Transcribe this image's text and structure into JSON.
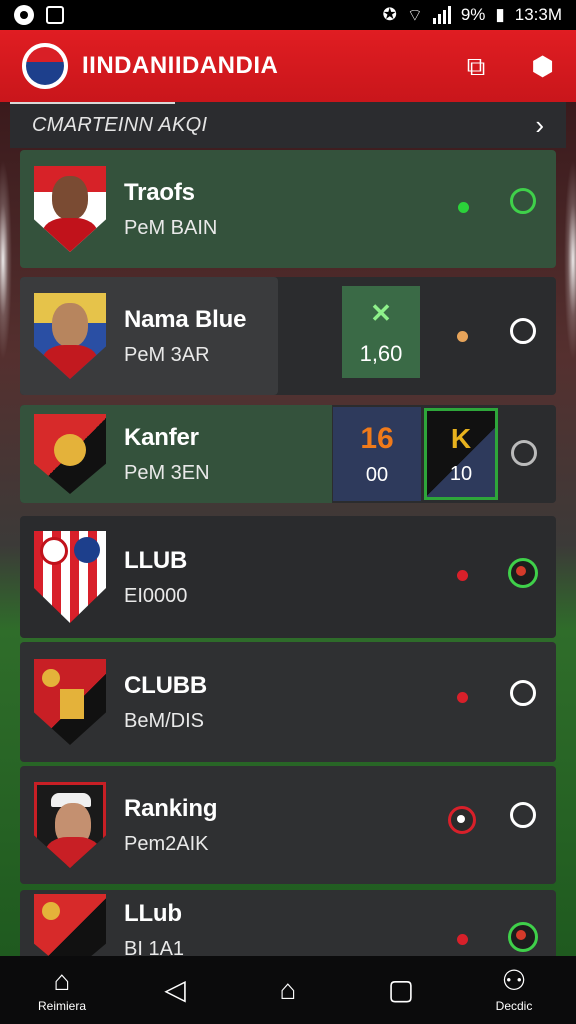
{
  "status_bar": {
    "battery": "9%",
    "time": "13:3M"
  },
  "app_bar": {
    "title": "IINDANIIDANDIA",
    "icons": [
      "team-logo-icon",
      "share-icon",
      "settings-icon"
    ]
  },
  "section": {
    "title": "CMARTEINN AKQI"
  },
  "rows": [
    {
      "name": "Traofs",
      "sub": "PeM BAIN",
      "dot_color": "#2bd23a",
      "indicator": "green-ring"
    },
    {
      "name": "Nama Blue",
      "sub": "PeM 3AR",
      "score": "1,60",
      "score_icon": "✕",
      "dot_color": "#e7a45a",
      "indicator": "white-ring"
    },
    {
      "name": "Kanfer",
      "sub": "PeM 3EN",
      "score_a_top": "16",
      "score_a_bottom": "00",
      "score_b_top": "K",
      "score_b_bottom": "10",
      "indicator": "white-ring"
    },
    {
      "name": "LLUB",
      "sub": "EI0000",
      "dot_color": "#d8202a",
      "indicator": "green-red-ring"
    },
    {
      "name": "CLUBB",
      "sub": "BeM/DIS",
      "dot_color": "#d8202a",
      "indicator": "white-ring"
    },
    {
      "name": "Ranking",
      "sub": "Pem2AIK",
      "indicator": "white-ring"
    },
    {
      "name": "LLub",
      "sub": "BI 1A1",
      "dot_color": "#d8202a",
      "indicator": "green-red-ring"
    }
  ],
  "nav": {
    "home_label": "Reimiera",
    "profile_label": "Decdic"
  },
  "colors": {
    "brand_red": "#e01d22",
    "row_dark": "#323335",
    "row_green": "#34523c",
    "accent_green": "#3fd04a"
  }
}
